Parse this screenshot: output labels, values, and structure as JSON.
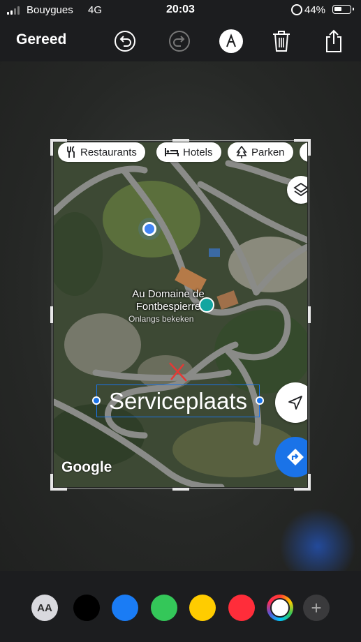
{
  "status_bar": {
    "carrier": "Bouygues",
    "network": "4G",
    "time": "20:03",
    "battery_percent": "44%",
    "battery_level": 0.44,
    "signal_bars": 2
  },
  "toolbar": {
    "done_label": "Gereed",
    "icons": [
      "undo-icon",
      "redo-icon",
      "markup-pen-icon",
      "trash-icon",
      "share-icon"
    ]
  },
  "map": {
    "chips": [
      {
        "icon": "fork-knife-icon",
        "label": "Restaurants"
      },
      {
        "icon": "bed-icon",
        "label": "Hotels"
      },
      {
        "icon": "tree-icon",
        "label": "Parken"
      }
    ],
    "place_name": "Au Domaine de Fontbespierre",
    "place_line1": "Au Domaine de",
    "place_line2": "Fontbespierre",
    "place_status": "Onlangs bekeken",
    "attribution": "Google"
  },
  "annotation": {
    "text": "Serviceplaats"
  },
  "palette": {
    "text_style_label": "AA",
    "colors": [
      "#000000",
      "#1a7cf5",
      "#34c759",
      "#ffcc00",
      "#ff2d3a"
    ],
    "add_label": "+"
  }
}
